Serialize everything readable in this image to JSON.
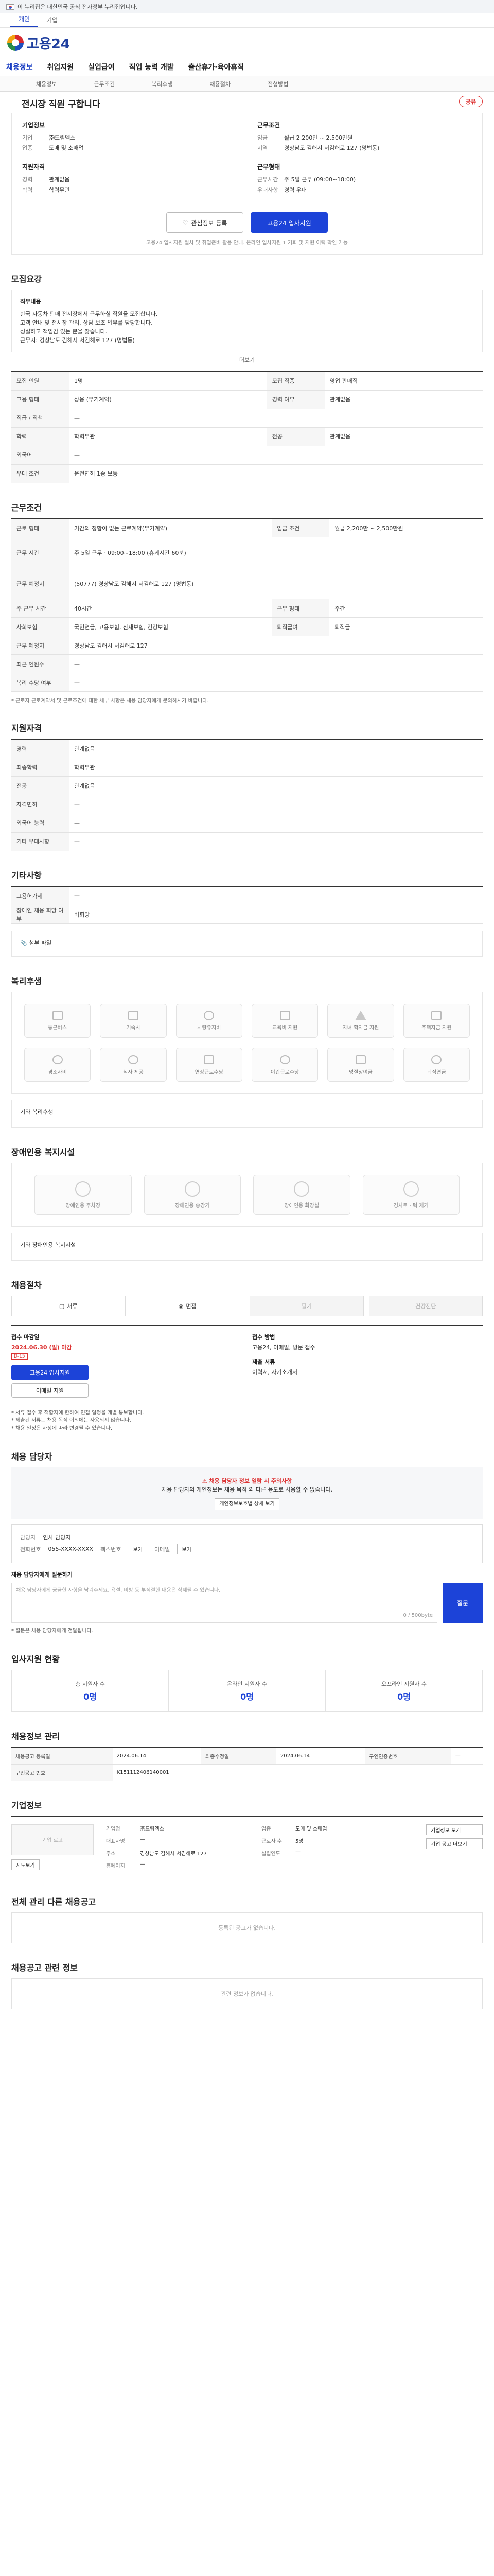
{
  "gov_banner": {
    "text": "이 누리집은 대한민국 공식 전자정부 누리집입니다."
  },
  "site_tabs": [
    "개인",
    "기업"
  ],
  "logo": {
    "name": "고용24"
  },
  "gnb": [
    "채용정보",
    "취업지원",
    "실업급여",
    "직업 능력 개발",
    "출산휴가·육아휴직"
  ],
  "lnb": [
    "채용정보",
    "근무조건",
    "복리후생",
    "채용절차",
    "전형방법"
  ],
  "title": "전시장 직원 구합니다",
  "share_label": "공유",
  "summary": {
    "company_h": "기업정보",
    "company_name_k": "기업",
    "company_name": "㈜드림엑스",
    "industry_k": "업종",
    "industry": "도매 및 소매업",
    "cond_h": "근무조건",
    "wage_k": "임금",
    "wage": "월급 2,200만 ~ 2,500만원",
    "loc_k": "지역",
    "loc": "경상남도 김해시 서김해로 127 (명법동)",
    "req_h": "지원자격",
    "career_k": "경력",
    "career": "관계없음",
    "edu_k": "학력",
    "edu": "학력무관",
    "time_h": "근무형태",
    "time_k": "근무시간",
    "time": "주 5일 근무 (09:00~18:00)",
    "pref_k": "우대사항",
    "pref": "경력 우대"
  },
  "buttons": {
    "scrap": "관심정보 등록",
    "apply": "고용24 입사지원"
  },
  "apply_note": "고용24 입사지원 절차 및 취업준비 활용 안내. 온라인 입사지원 1 기회 및 지원 이력 확인 가능",
  "sections": {
    "recruit": "모집요강",
    "work": "근무조건",
    "qualify": "지원자격",
    "other": "기타사항",
    "welfare": "복리후생",
    "disability": "장애인용 복지시설",
    "process": "채용절차",
    "manager": "채용 담당자",
    "stats": "입사지원 현황",
    "info": "채용정보 관리",
    "company": "기업정보",
    "similar": "전체 관리 다른 채용공고",
    "notice": "채용공고 관련 정보"
  },
  "recruit_box": {
    "head": "직무내용",
    "lines": [
      "한국 자동차 판매 전시장에서 근무하실 직원을 모집합니다.",
      "고객 안내 및 전시장 관리, 상담 보조 업무를 담당합니다.",
      "성실하고 책임감 있는 분을 찾습니다.",
      "근무지: 경상남도 김해시 서김해로 127 (명법동)"
    ],
    "more": "더보기"
  },
  "recruit_rows": [
    {
      "k": "모집 인원",
      "v": "1명",
      "k2": "모집 직종",
      "v2": "영업 판매직"
    },
    {
      "k": "고용 형태",
      "v": "상용 (무기계약)",
      "k2": "경력 여부",
      "v2": "관계없음"
    },
    {
      "k": "직급 / 직책",
      "v": "—",
      "k2": "",
      "v2": ""
    },
    {
      "k": "학력",
      "v": "학력무관",
      "k2": "전공",
      "v2": "관계없음"
    },
    {
      "k": "외국어",
      "v": "—",
      "k2": "",
      "v2": ""
    },
    {
      "k": "우대 조건",
      "v": "운전면허 1종 보통",
      "k2": "",
      "v2": ""
    }
  ],
  "work_rows": [
    {
      "k": "근로 형태",
      "v": "기간의 정함이 없는 근로계약(무기계약)",
      "k2": "임금 조건",
      "v2": "월급 2,200만 ~ 2,500만원"
    },
    {
      "k": "근무 시간",
      "v": "주 5일 근무 · 09:00~18:00 (휴게시간 60분)",
      "k2": "",
      "v2": ""
    },
    {
      "k": "근무 예정지",
      "v": "(50777) 경상남도 김해시 서김해로 127 (명법동)",
      "k2": "",
      "v2": ""
    },
    {
      "k": "주 근무 시간",
      "v": "40시간",
      "k2": "근무 형태",
      "v2": "주간"
    },
    {
      "k": "사회보험",
      "v": "국민연금, 고용보험, 산재보험, 건강보험",
      "k2": "퇴직급여",
      "v2": "퇴직금"
    },
    {
      "k": "근무 예정지",
      "v": "경상남도 김해시 서김해로 127",
      "k2": "",
      "v2": ""
    },
    {
      "k": "최근 인원수",
      "v": "—",
      "k2": "",
      "v2": ""
    },
    {
      "k": "복리 수당 여부",
      "v": "—",
      "k2": "",
      "v2": ""
    }
  ],
  "work_footnote": "* 근로자 근로계약서 및 근로조건에 대한 세부 사항은 채용 담당자에게 문의하시기 바랍니다.",
  "qualify_rows": [
    {
      "k": "경력",
      "v": "관계없음"
    },
    {
      "k": "최종학력",
      "v": "학력무관"
    },
    {
      "k": "전공",
      "v": "관계없음"
    },
    {
      "k": "자격면허",
      "v": "—"
    },
    {
      "k": "외국어 능력",
      "v": "—"
    },
    {
      "k": "기타 우대사항",
      "v": "—"
    }
  ],
  "other_rows": [
    {
      "k": "고용허가제",
      "v": "—"
    },
    {
      "k": "장애인 채용 희망 여부",
      "v": "비희망"
    }
  ],
  "other_attach": "첨부 파일",
  "welfare_items": [
    "통근버스",
    "기숙사",
    "차량유지비",
    "교육비 지원",
    "자녀 학자금 지원",
    "주택자금 지원",
    "경조사비",
    "식사 제공",
    "연장근로수당",
    "야간근로수당",
    "명절상여금",
    "퇴직연금"
  ],
  "welfare_footer": "기타 복리후생",
  "disability_items": [
    "장애인용 주차장",
    "장애인용 승강기",
    "장애인용 화장실",
    "경사로 · 턱 제거"
  ],
  "disability_footer": "기타 장애인용 복지시설",
  "process_steps": [
    "서류",
    "면접",
    "필기",
    "건강진단"
  ],
  "apply": {
    "period_h": "접수 마감일",
    "period": "2024.06.30 (일) 마감",
    "dday": "D-15",
    "method_h": "접수 방법",
    "method": "고용24, 이메일, 방문 접수",
    "docs_h": "제출 서류",
    "docs": "이력서, 자기소개서",
    "btn_apply": "고용24 입사지원",
    "btn_email": "이메일 지원"
  },
  "process_bullets": [
    "* 서류 접수 후 적합자에 한하여 면접 일정을 개별 통보합니다.",
    "* 제출된 서류는 채용 목적 이외에는 사용되지 않습니다.",
    "* 채용 일정은 사정에 따라 변경될 수 있습니다."
  ],
  "manager": {
    "warn_title": "채용 담당자 정보 열람 시 주의사항",
    "warn_text": "채용 담당자의 개인정보는 채용 목적 외 다른 용도로 사용할 수 없습니다.",
    "warn_btn": "개인정보보호법 상세 보기",
    "name_k": "담당자",
    "name": "인사 담당자",
    "tel_k": "전화번호",
    "tel": "055-XXXX-XXXX",
    "fax_k": "팩스번호",
    "email_k": "이메일",
    "btn_view": "보기",
    "q_title": "채용 담당자에게 질문하기",
    "q_note": "* 질문은 채용 담당자에게 전달됩니다.",
    "q_placeholder": "채용 담당자에게 궁금한 사항을 남겨주세요. 욕설, 비방 등 부적절한 내용은 삭제될 수 있습니다.",
    "q_count": "0 / 500byte",
    "q_btn": "질문"
  },
  "stats": [
    {
      "k": "총 지원자 수",
      "v": "0명"
    },
    {
      "k": "온라인 지원자 수",
      "v": "0명"
    },
    {
      "k": "오프라인 지원자 수",
      "v": "0명"
    }
  ],
  "info_rows": [
    {
      "k": "채용공고 등록일",
      "v": "2024.06.14",
      "k2": "최종수정일",
      "v2": "2024.06.14",
      "k3": "구인인증번호",
      "v3": "—"
    },
    {
      "k": "구인공고 번호",
      "v": "K151112406140001",
      "k2": "",
      "v2": "",
      "k3": "",
      "v3": ""
    }
  ],
  "company": {
    "logo_alt": "기업 로고",
    "rows": [
      {
        "k": "기업명",
        "v": "㈜드림엑스",
        "k2": "업종",
        "v2": "도매 및 소매업"
      },
      {
        "k": "대표자명",
        "v": "—",
        "k2": "근로자 수",
        "v2": "5명"
      },
      {
        "k": "주소",
        "v": "경상남도 김해시 서김해로 127",
        "k2": "설립연도",
        "v2": "—"
      },
      {
        "k": "홈페이지",
        "v": "—",
        "k2": "",
        "v2": ""
      }
    ],
    "btn_map": "지도보기",
    "btn_info": "기업정보 보기",
    "btn_more": "기업 공고 더보기"
  },
  "similar_empty": "등록된 공고가 없습니다.",
  "notice_empty": "관련 정보가 없습니다."
}
